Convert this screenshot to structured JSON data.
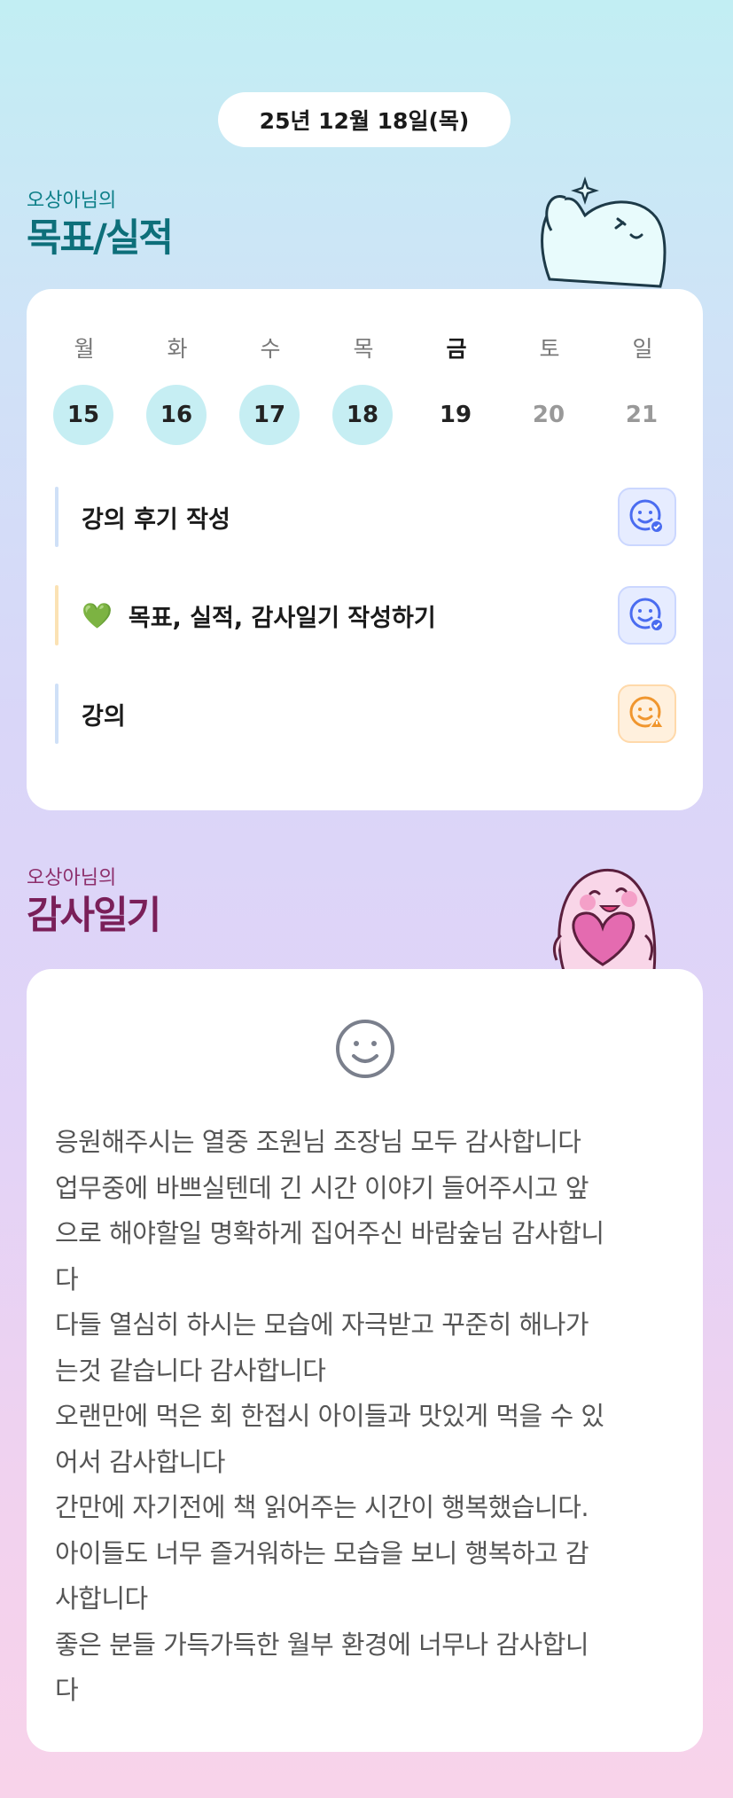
{
  "header": {
    "date": "25년 12월 18일(목)"
  },
  "goal_section": {
    "subtitle": "오상아님의",
    "title": "목표/실적",
    "week": [
      {
        "day": "월",
        "date": "15",
        "state": "done"
      },
      {
        "day": "화",
        "date": "16",
        "state": "done"
      },
      {
        "day": "수",
        "date": "17",
        "state": "done"
      },
      {
        "day": "목",
        "date": "18",
        "state": "done"
      },
      {
        "day": "금",
        "date": "19",
        "state": "today"
      },
      {
        "day": "토",
        "date": "20",
        "state": "future"
      },
      {
        "day": "일",
        "date": "21",
        "state": "future"
      }
    ],
    "tasks": [
      {
        "label": "강의 후기 작성",
        "bar_color": "#cfe0f7",
        "status_icon": "smiley-check-icon",
        "status_color": "#4a6cf0"
      },
      {
        "label": "목표, 실적, 감사일기 작성하기",
        "bar_color": "#fbe2b4",
        "status_icon": "smiley-check-icon",
        "status_color": "#4a6cf0",
        "emoji": "💚"
      },
      {
        "label": "강의",
        "bar_color": "#cfe0f7",
        "status_icon": "smiley-warning-icon",
        "status_color": "#f0962e"
      }
    ]
  },
  "diary_section": {
    "subtitle": "오상아님의",
    "title": "감사일기",
    "lines": [
      "응원해주시는 열중 조원님 조장님 모두 감사합니다",
      "업무중에 바쁘실텐데 긴 시간 이야기 들어주시고 앞",
      "으로 해야할일 명확하게 집어주신 바람숲님 감사합니",
      "다",
      "다들 열심히 하시는 모습에 자극받고 꾸준히 해나가",
      "는것 같습니다 감사합니다",
      "오랜만에 먹은 회 한접시 아이들과 맛있게 먹을 수 있",
      "어서 감사합니다",
      "간만에 자기전에 책 읽어주는 시간이 행복했습니다.",
      "아이들도 너무 즐거워하는 모습을 보니 행복하고 감",
      "사합니다",
      "좋은 분들 가득가득한 월부 환경에 너무나 감사합니",
      "다"
    ]
  },
  "colors": {
    "goal_title": "#0d6f7a",
    "diary_title": "#7a1f59",
    "done_circle": "#c6eef3"
  }
}
